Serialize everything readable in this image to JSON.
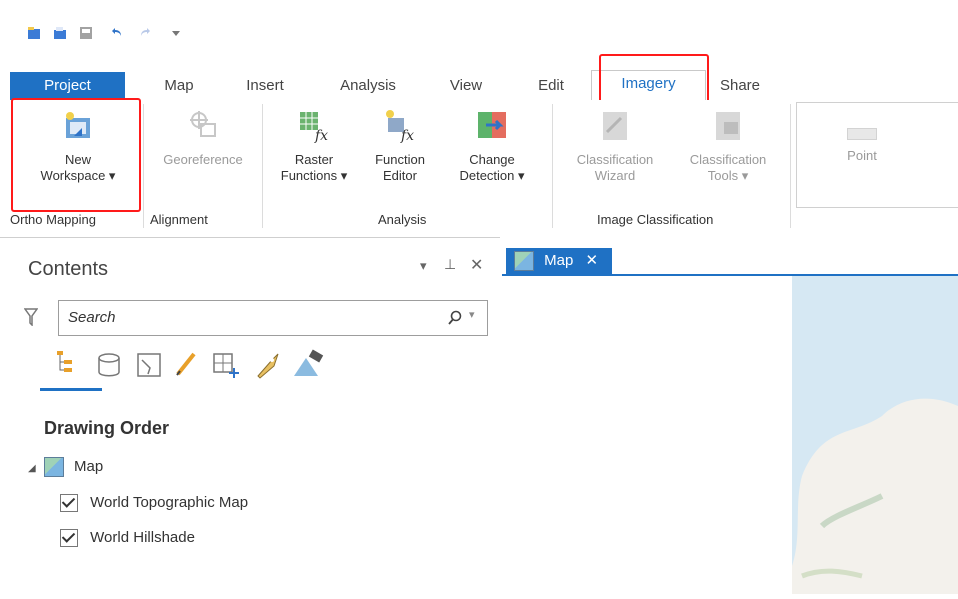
{
  "tabs": {
    "project": "Project",
    "map": "Map",
    "insert": "Insert",
    "analysis": "Analysis",
    "view": "View",
    "edit": "Edit",
    "imagery": "Imagery",
    "share": "Share"
  },
  "ribbon": {
    "ortho": {
      "new_workspace_line1": "New",
      "new_workspace_line2": "Workspace ▾",
      "group": "Ortho Mapping"
    },
    "alignment": {
      "georeference": "Georeference",
      "group": "Alignment"
    },
    "analysis": {
      "raster_functions_1": "Raster",
      "raster_functions_2": "Functions ▾",
      "function_editor_1": "Function",
      "function_editor_2": "Editor",
      "change_detection_1": "Change",
      "change_detection_2": "Detection ▾",
      "group": "Analysis"
    },
    "image_class": {
      "wizard_1": "Classification",
      "wizard_2": "Wizard",
      "tools_1": "Classification",
      "tools_2": "Tools ▾",
      "group": "Image Classification"
    },
    "point": "Point"
  },
  "contents": {
    "title": "Contents",
    "search_placeholder": "Search",
    "drawing_order": "Drawing Order",
    "map_item": "Map",
    "layers": [
      "World Topographic Map",
      "World Hillshade"
    ]
  },
  "map_view": {
    "tab": "Map"
  },
  "colors": {
    "accent": "#1f71c4",
    "annotation": "#ff1a1a"
  }
}
